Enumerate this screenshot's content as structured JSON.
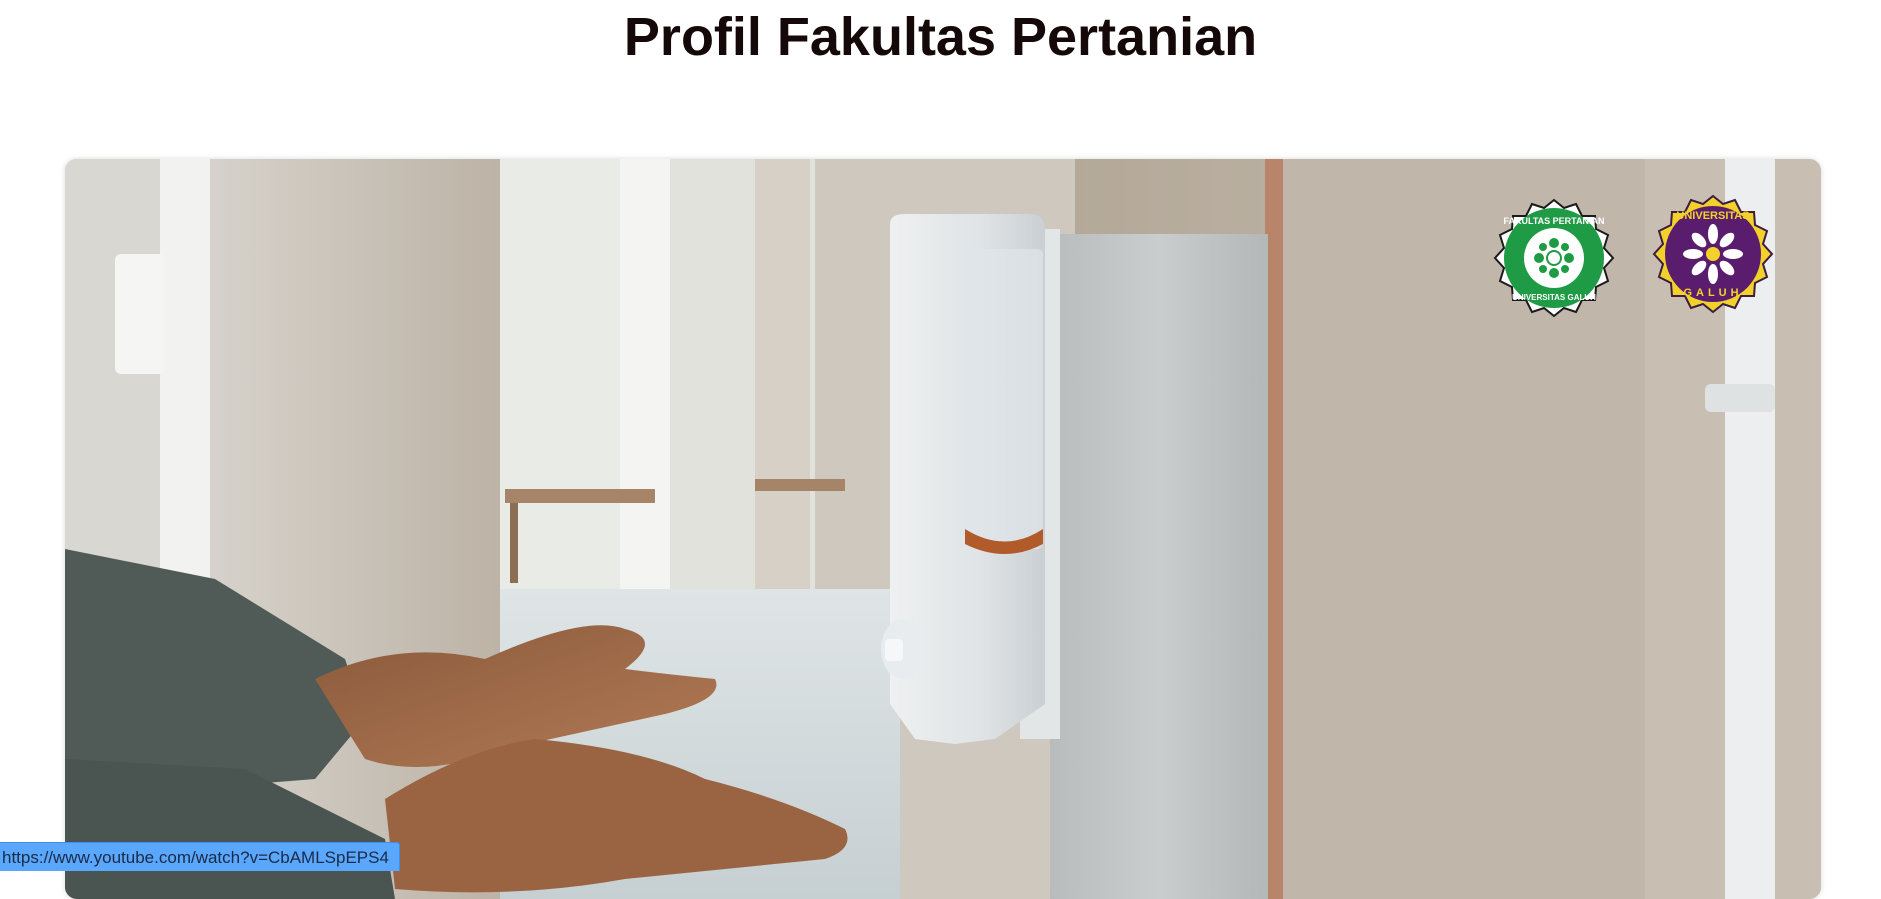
{
  "page": {
    "title": "Profil Fakultas Pertanian"
  },
  "video": {
    "logo_faculty": {
      "top_text": "FAKULTAS PERTANIAN",
      "bottom_text": "UNIVERSITAS GALUH",
      "color": "#1f9a45"
    },
    "logo_university": {
      "top_text": "UNIVERSITAS",
      "bottom_text": "GALUH",
      "color": "#5a1d6e",
      "ring_color": "#f2d22a"
    }
  },
  "status_bar": {
    "url": "https://www.youtube.com/watch?v=CbAMLSpEPS4"
  }
}
